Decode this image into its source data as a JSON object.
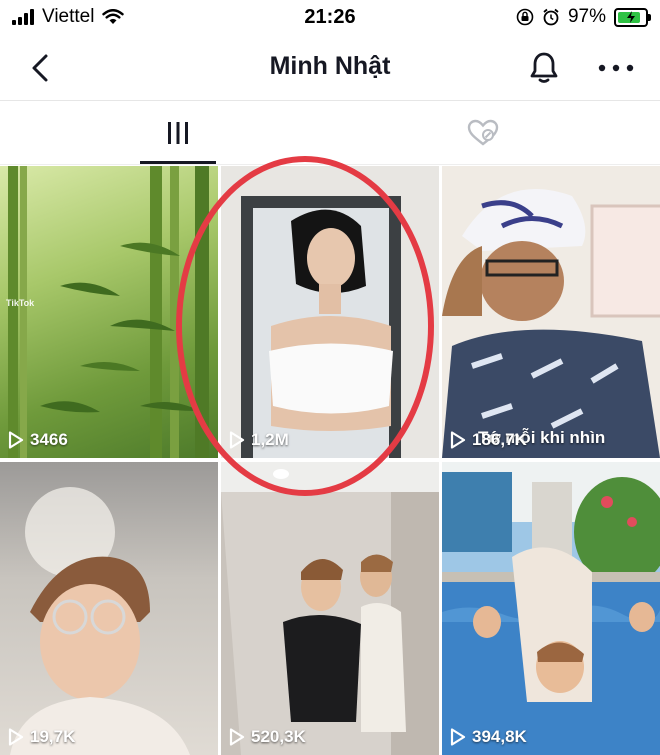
{
  "status": {
    "carrier": "Viettel",
    "time": "21:26",
    "battery": "97%"
  },
  "header": {
    "title": "Minh Nhật"
  },
  "tabs": [
    {
      "name": "videos",
      "icon": "grid-bars-icon",
      "active": true
    },
    {
      "name": "liked",
      "icon": "liked-hidden-icon",
      "active": false
    }
  ],
  "videos": [
    {
      "views": "3466",
      "watermark": "TikTok"
    },
    {
      "views": "1,2M"
    },
    {
      "views": "186,7K",
      "caption": "Tớ mỗi khi nhìn"
    },
    {
      "views": "19,7K"
    },
    {
      "views": "520,3K"
    },
    {
      "views": "394,8K"
    }
  ],
  "colors": {
    "accent": "#161823",
    "highlight_ring": "#e43b44",
    "battery": "#2fc244"
  }
}
